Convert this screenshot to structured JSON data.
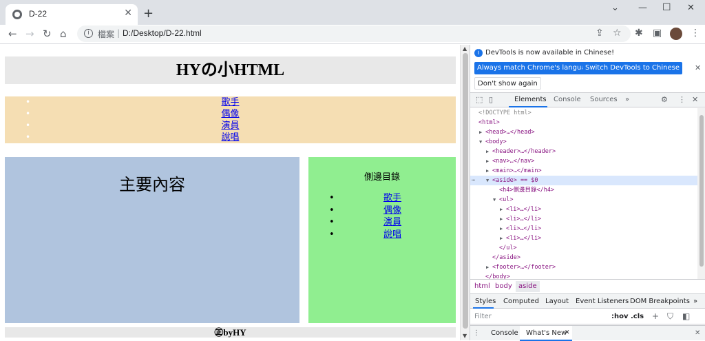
{
  "browser": {
    "tab_title": "D-22",
    "tab_close": "✕",
    "new_tab": "+",
    "address_label": "檔案",
    "address_sep": "|",
    "url": "D:/Desktop/D-22.html"
  },
  "page": {
    "header_title": "HYの小HTML",
    "nav_items": [
      "歌手",
      "偶像",
      "演員",
      "說唱"
    ],
    "main_title": "主要內容",
    "aside_title": "側邊目錄",
    "aside_items": [
      "歌手",
      "偶像",
      "演員",
      "說唱"
    ],
    "footer_text": "㊣byHY",
    "colors": {
      "header_bg": "#e8e8e8",
      "nav_bg": "#f5deb3",
      "main_bg": "#b0c4de",
      "aside_bg": "#90ee90",
      "link": "#0000ee"
    }
  },
  "devtools": {
    "banner_text": "DevTools is now available in Chinese!",
    "btn_match": "Always match Chrome's language",
    "btn_switch": "Switch DevTools to Chinese",
    "btn_dont_show": "Don't show again",
    "tabs": [
      "Elements",
      "Console",
      "Sources"
    ],
    "more_tabs": "»",
    "dom_lines": [
      {
        "text": "<!DOCTYPE html>",
        "indent": 0,
        "arrow": "",
        "kind": "dim"
      },
      {
        "text": "<html>",
        "indent": 0,
        "arrow": "",
        "kind": "tag"
      },
      {
        "text": "<head>…</head>",
        "indent": 1,
        "arrow": "▶",
        "kind": "tag"
      },
      {
        "text": "<body>",
        "indent": 1,
        "arrow": "▼",
        "kind": "tag"
      },
      {
        "text": "<header>…</header>",
        "indent": 2,
        "arrow": "▶",
        "kind": "tag"
      },
      {
        "text": "<nav>…</nav>",
        "indent": 2,
        "arrow": "▶",
        "kind": "tag"
      },
      {
        "text": "<main>…</main>",
        "indent": 2,
        "arrow": "▶",
        "kind": "tag"
      },
      {
        "text": "<aside> == $0",
        "indent": 2,
        "arrow": "▼",
        "kind": "sel"
      },
      {
        "text": "<h4>側邊目錄</h4>",
        "indent": 3,
        "arrow": "",
        "kind": "tag"
      },
      {
        "text": "<ul>",
        "indent": 3,
        "arrow": "▼",
        "kind": "tag"
      },
      {
        "text": "<li>…</li>",
        "indent": 4,
        "arrow": "▶",
        "kind": "tag"
      },
      {
        "text": "<li>…</li>",
        "indent": 4,
        "arrow": "▶",
        "kind": "tag"
      },
      {
        "text": "<li>…</li>",
        "indent": 4,
        "arrow": "▶",
        "kind": "tag"
      },
      {
        "text": "<li>…</li>",
        "indent": 4,
        "arrow": "▶",
        "kind": "tag"
      },
      {
        "text": "</ul>",
        "indent": 3,
        "arrow": "",
        "kind": "tag"
      },
      {
        "text": "</aside>",
        "indent": 2,
        "arrow": "",
        "kind": "tag"
      },
      {
        "text": "<footer>…</footer>",
        "indent": 2,
        "arrow": "▶",
        "kind": "tag"
      },
      {
        "text": "</body>",
        "indent": 1,
        "arrow": "",
        "kind": "tag"
      }
    ],
    "breadcrumbs": [
      "html",
      "body",
      "aside"
    ],
    "styles_tabs": [
      "Styles",
      "Computed",
      "Layout",
      "Event Listeners",
      "DOM Breakpoints"
    ],
    "filter_placeholder": "Filter",
    "hov": ":hov",
    "cls": ".cls",
    "drawer_tabs": [
      "Console",
      "What's New"
    ],
    "drawer_close": "✕"
  }
}
